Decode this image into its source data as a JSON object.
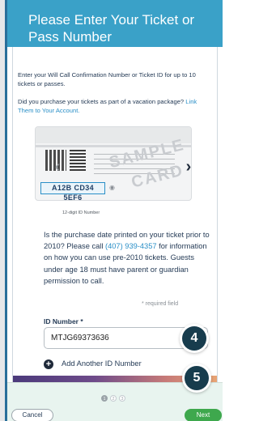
{
  "header": {
    "title": "Please Enter Your Ticket or Pass Number"
  },
  "intro": {
    "text": "Enter your Will Call Confirmation Number or Ticket ID for up to 10 tickets or passes."
  },
  "vacation": {
    "question": "Did you purchase your tickets as part of a vacation package?",
    "link": "Link Them to Your Account."
  },
  "sample_card": {
    "watermark_1": "SAMPLE",
    "watermark_2": "CARD",
    "id_example": "A12B CD34 5EF6",
    "caption": "12-digit ID Number"
  },
  "info": {
    "text_before_phone": "Is the purchase date printed on your ticket prior to 2010? Please call ",
    "phone": "(407) 939-4357",
    "text_after_phone": " for information on how you can use pre-2010 tickets. Guests under age 18 must have parent or guardian permission to call."
  },
  "form": {
    "required_note": "* required field",
    "id_label": "ID Number *",
    "id_value": "MTJG69373636",
    "add_label": "Add Another ID Number"
  },
  "badges": {
    "four": "4",
    "five": "5"
  },
  "pager": {
    "pages": [
      "1",
      "2",
      "3"
    ],
    "current_index": 0
  },
  "buttons": {
    "cancel": "Cancel",
    "next": "Next"
  },
  "colors": {
    "header_bg": "#3aa1c8",
    "link": "#2a8fc7",
    "next_button": "#3ea84d",
    "badge": "#173c4d"
  }
}
